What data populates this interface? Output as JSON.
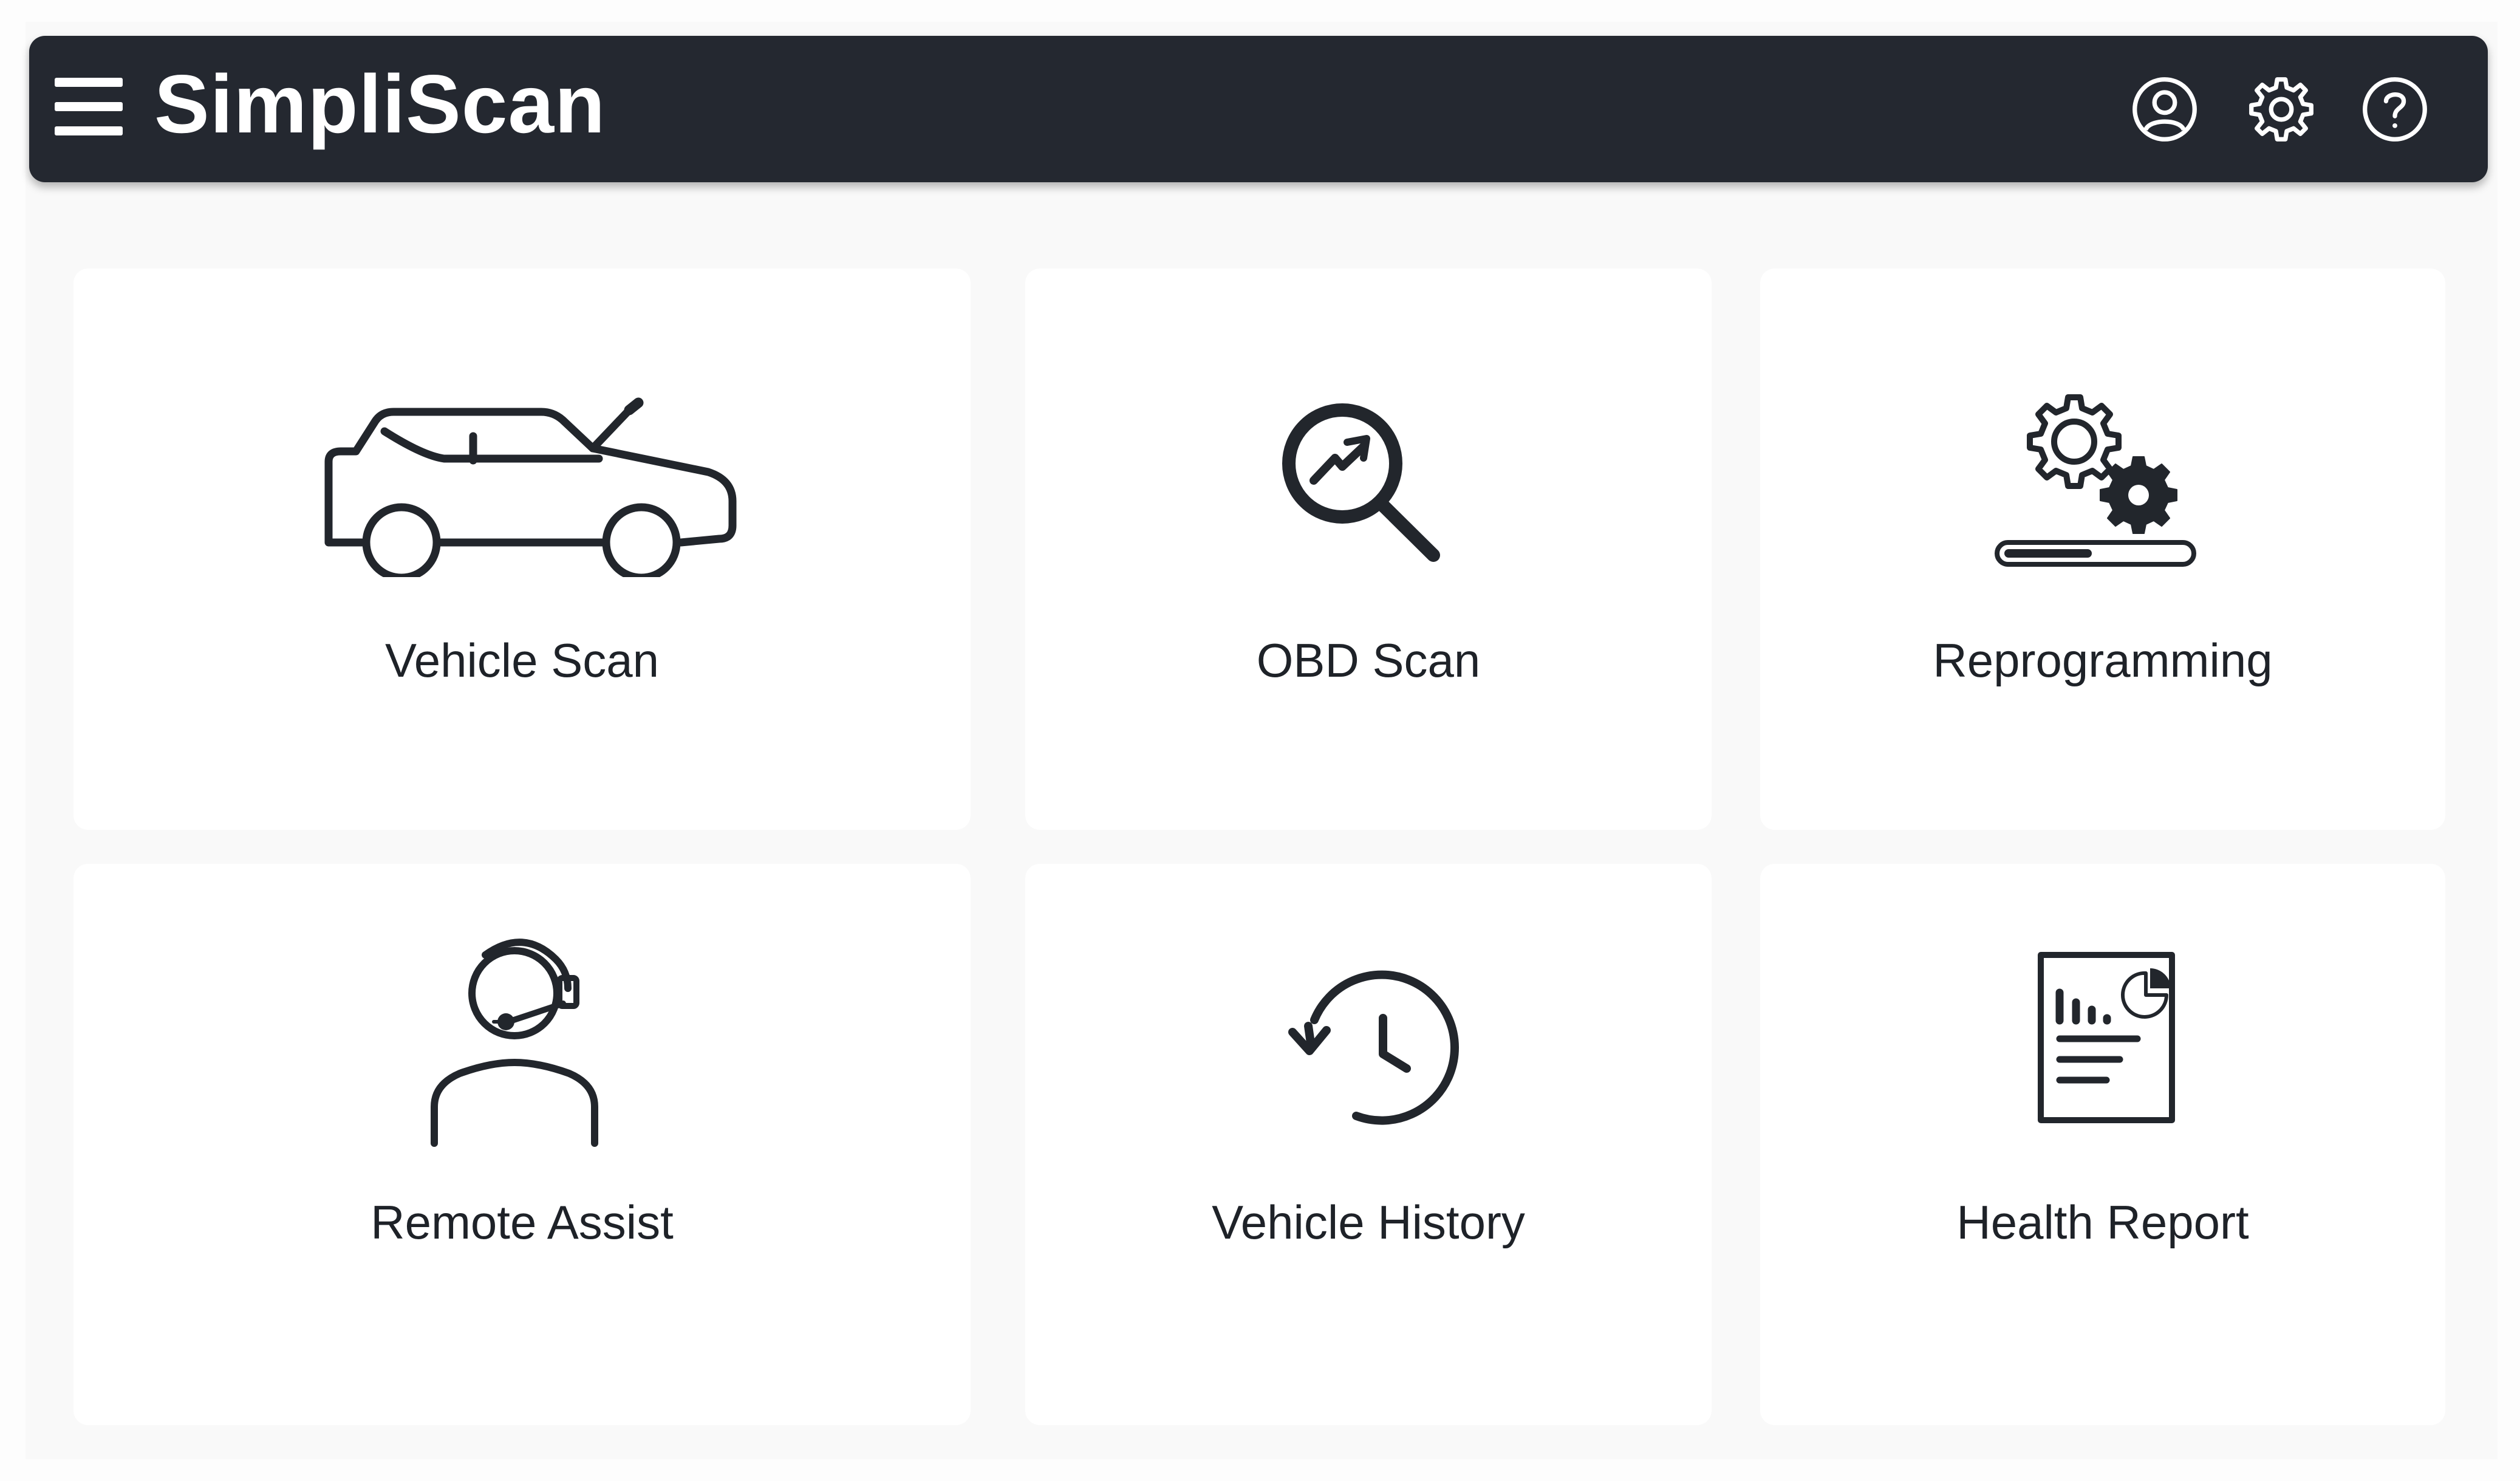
{
  "app": {
    "title": "SimpliScan"
  },
  "header": {
    "menu_icon": "hamburger-menu-icon",
    "actions": [
      {
        "name": "account",
        "icon": "user-circle-icon"
      },
      {
        "name": "settings",
        "icon": "gear-icon"
      },
      {
        "name": "help",
        "icon": "question-circle-icon"
      }
    ]
  },
  "tiles": [
    {
      "label": "Vehicle Scan",
      "icon": "car-hood-open-icon"
    },
    {
      "label": "OBD Scan",
      "icon": "magnifier-pulse-icon"
    },
    {
      "label": "Reprogramming",
      "icon": "gears-progress-icon"
    },
    {
      "label": "Remote Assist",
      "icon": "headset-agent-icon"
    },
    {
      "label": "Vehicle History",
      "icon": "history-clock-icon"
    },
    {
      "label": "Health Report",
      "icon": "report-chart-icon"
    }
  ],
  "reprogramming_progress": 0.48,
  "colors": {
    "header_bg": "#242830",
    "header_text": "#ffffff",
    "icon_stroke": "#22262c",
    "tile_bg": "#ffffff",
    "page_bg": "#f9f9f9"
  }
}
